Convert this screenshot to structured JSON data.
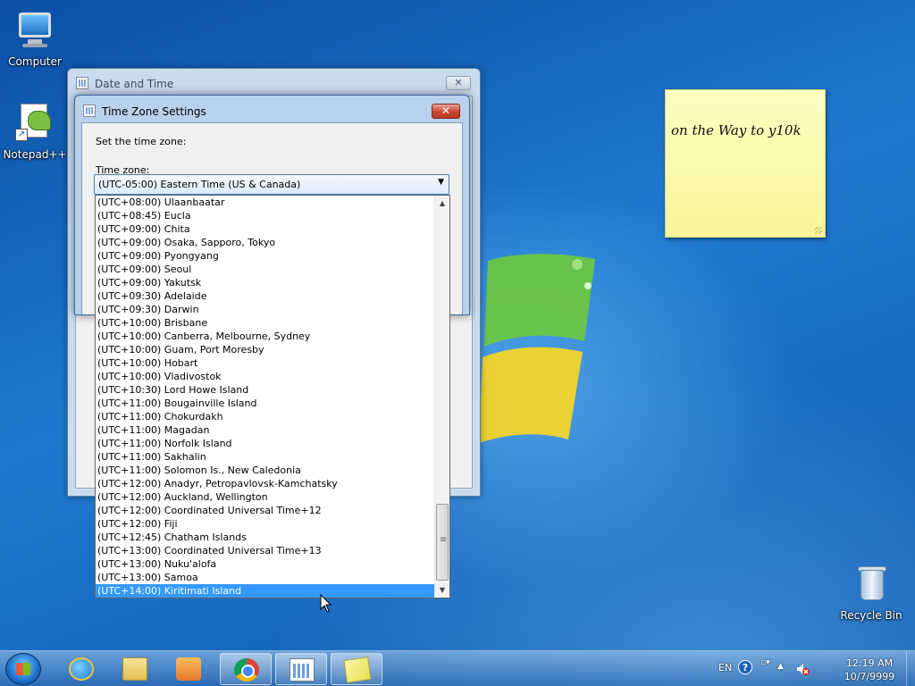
{
  "desktop": {
    "icons": [
      {
        "label": "Computer"
      },
      {
        "label": "Notepad++"
      },
      {
        "label": "Recycle Bin"
      }
    ],
    "sticky_note": {
      "text": "on the Way to y10k"
    }
  },
  "back_window": {
    "title": "Date and Time",
    "close_glyph": "✕"
  },
  "dialog": {
    "title": "Time Zone Settings",
    "close_glyph": "✕",
    "instruction": "Set the time zone:",
    "field_label": "Time zone:",
    "selected_value": "(UTC-05:00) Eastern Time (US & Canada)",
    "dropdown_arrow": "▼"
  },
  "timezone_list": {
    "items": [
      "(UTC+08:00) Ulaanbaatar",
      "(UTC+08:45) Eucla",
      "(UTC+09:00) Chita",
      "(UTC+09:00) Osaka, Sapporo, Tokyo",
      "(UTC+09:00) Pyongyang",
      "(UTC+09:00) Seoul",
      "(UTC+09:00) Yakutsk",
      "(UTC+09:30) Adelaide",
      "(UTC+09:30) Darwin",
      "(UTC+10:00) Brisbane",
      "(UTC+10:00) Canberra, Melbourne, Sydney",
      "(UTC+10:00) Guam, Port Moresby",
      "(UTC+10:00) Hobart",
      "(UTC+10:00) Vladivostok",
      "(UTC+10:30) Lord Howe Island",
      "(UTC+11:00) Bougainville Island",
      "(UTC+11:00) Chokurdakh",
      "(UTC+11:00) Magadan",
      "(UTC+11:00) Norfolk Island",
      "(UTC+11:00) Sakhalin",
      "(UTC+11:00) Solomon Is., New Caledonia",
      "(UTC+12:00) Anadyr, Petropavlovsk-Kamchatsky",
      "(UTC+12:00) Auckland, Wellington",
      "(UTC+12:00) Coordinated Universal Time+12",
      "(UTC+12:00) Fiji",
      "(UTC+12:45) Chatham Islands",
      "(UTC+13:00) Coordinated Universal Time+13",
      "(UTC+13:00) Nuku'alofa",
      "(UTC+13:00) Samoa",
      "(UTC+14:00) Kiritimati Island"
    ],
    "highlighted_item": "(UTC+14:00) Kiritimati Island"
  },
  "taskbar": {
    "pinned": [
      {
        "name": "internet-explorer-icon",
        "open": false
      },
      {
        "name": "file-explorer-icon",
        "open": false
      },
      {
        "name": "media-player-icon",
        "open": false
      },
      {
        "name": "chrome-icon",
        "open": true
      },
      {
        "name": "date-time-icon",
        "open": true
      },
      {
        "name": "sticky-notes-icon",
        "open": true
      }
    ],
    "tray": {
      "language": "EN",
      "help_glyph": "?",
      "show_hidden_glyph": "▲",
      "time": "12:19 AM",
      "date": "10/7/9999"
    }
  },
  "colors": {
    "selection": "#3399ff",
    "close_active": "#c9472f",
    "sticky": "#fdfdc0"
  }
}
